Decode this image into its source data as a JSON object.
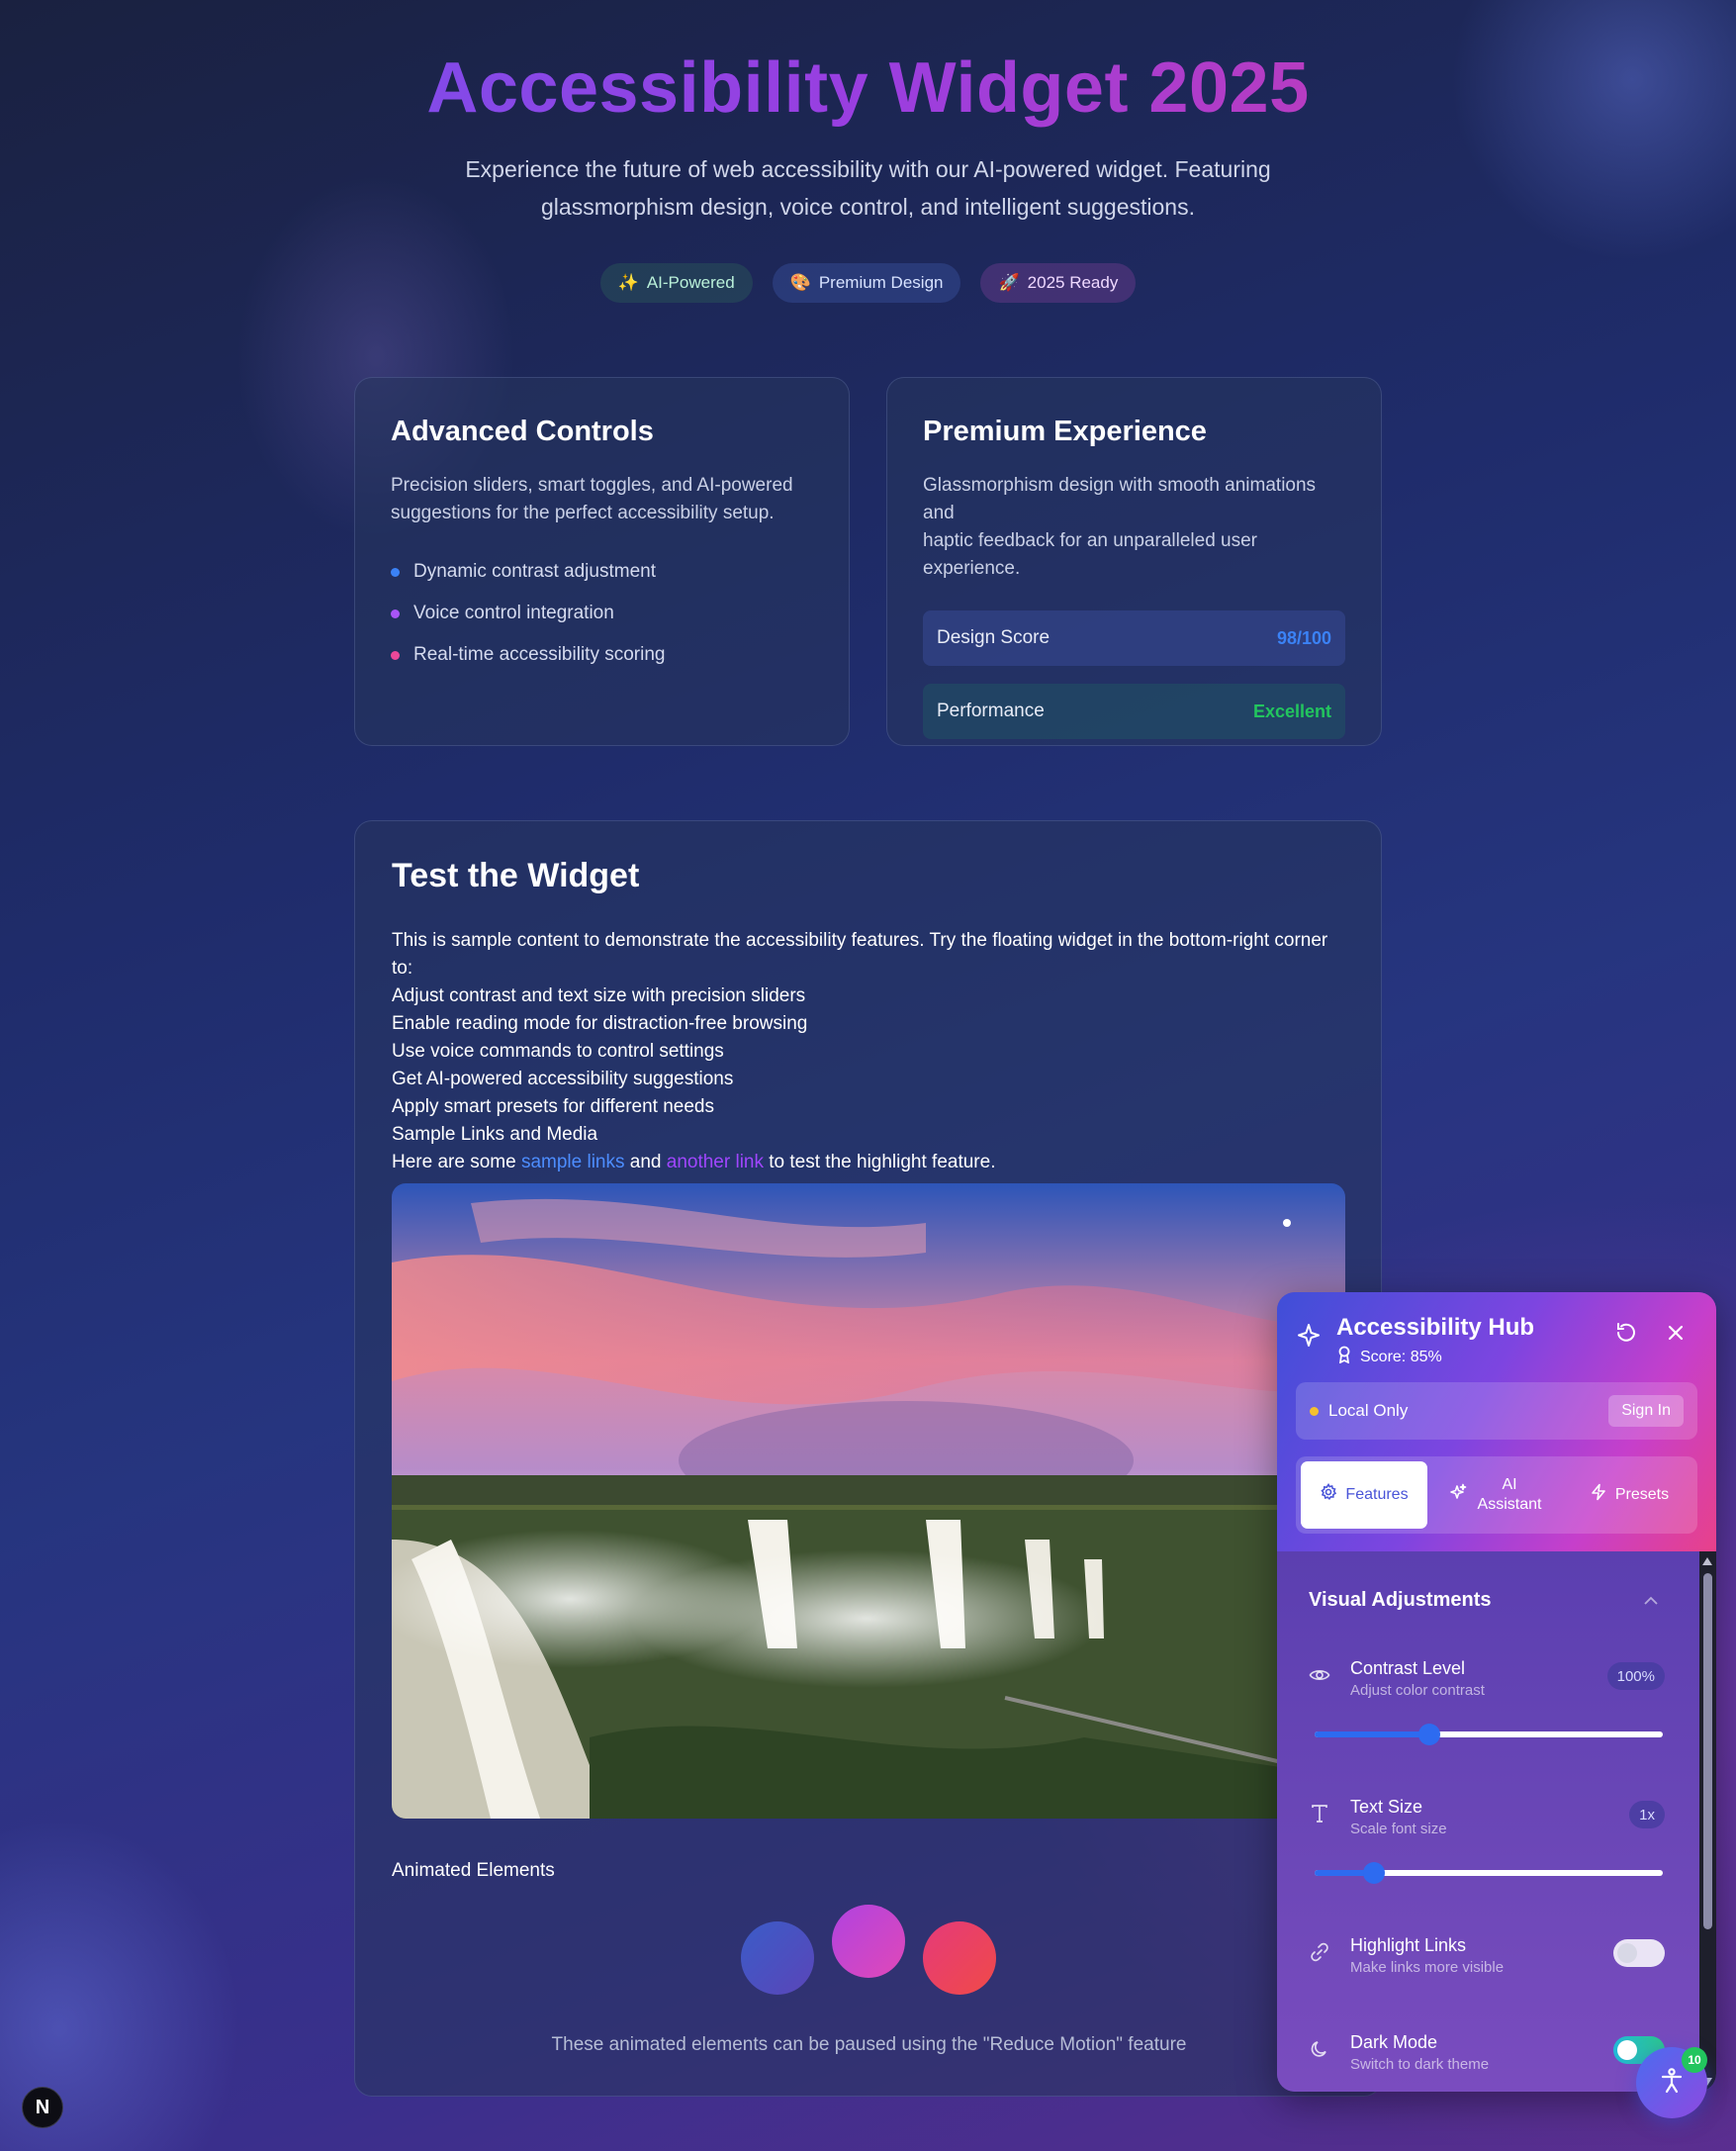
{
  "hero": {
    "title": "Accessibility Widget 2025",
    "subtitle_line1": "Experience the future of web accessibility with our AI-powered widget. Featuring",
    "subtitle_line2": "glassmorphism design, voice control, and intelligent suggestions.",
    "badges": [
      {
        "icon": "sparkles-icon",
        "emoji": "✨",
        "label": "AI-Powered"
      },
      {
        "icon": "palette-icon",
        "emoji": "🎨",
        "label": "Premium Design"
      },
      {
        "icon": "rocket-icon",
        "emoji": "🚀",
        "label": "2025 Ready"
      }
    ]
  },
  "controls_card": {
    "title": "Advanced Controls",
    "description_line1": "Precision sliders, smart toggles, and AI-powered",
    "description_line2": "suggestions for the perfect accessibility setup.",
    "features": [
      {
        "label": "Dynamic contrast adjustment",
        "color": "#3b82f6"
      },
      {
        "label": "Voice control integration",
        "color": "#a855f7"
      },
      {
        "label": "Real-time accessibility scoring",
        "color": "#ec4899"
      }
    ]
  },
  "premium_card": {
    "title": "Premium Experience",
    "description_line1": "Glassmorphism design with smooth animations and",
    "description_line2": "haptic feedback for an unparalleled user",
    "description_line3": "experience.",
    "metrics": [
      {
        "label": "Design Score",
        "value": "98/100",
        "color": "#3b82f6"
      },
      {
        "label": "Performance",
        "value": "Excellent",
        "color": "#22c55e"
      }
    ]
  },
  "test_card": {
    "title": "Test the Widget",
    "lines": [
      "This is sample content to demonstrate the accessibility features. Try the floating widget in the bottom-right corner to:",
      "Adjust contrast and text size with precision sliders",
      "Enable reading mode for distraction-free browsing",
      "Use voice commands to control settings",
      "Get AI-powered accessibility suggestions",
      "Apply smart presets for different needs",
      "Sample Links and Media"
    ],
    "links_prefix": "Here are some ",
    "link1": "sample links",
    "links_middle": " and ",
    "link2": "another link",
    "links_suffix": " to test the highlight feature.",
    "animated_label": "Animated Elements",
    "animated_note": "These animated elements can be paused using the \"Reduce Motion\" feature"
  },
  "widget": {
    "title": "Accessibility Hub",
    "score": "Score: 85%",
    "status": "Local Only",
    "sign_in": "Sign In",
    "tabs": [
      {
        "label": "Features",
        "icon": "gear-icon",
        "active": true
      },
      {
        "label": "AI Assistant",
        "icon": "sparkles-icon",
        "active": false
      },
      {
        "label": "Presets",
        "icon": "lightning-icon",
        "active": false
      }
    ],
    "section_title": "Visual Adjustments",
    "contrast": {
      "label": "Contrast Level",
      "sub": "Adjust color contrast",
      "value": "100%",
      "level": 0.33
    },
    "text_size": {
      "label": "Text Size",
      "sub": "Scale font size",
      "value": "1x",
      "level": 0.17
    },
    "highlight_links": {
      "label": "Highlight Links",
      "sub": "Make links more visible",
      "on": false
    },
    "dark_mode": {
      "label": "Dark Mode",
      "sub": "Switch to dark theme",
      "on": true
    },
    "fab_badge": "10"
  },
  "next_badge": "N"
}
